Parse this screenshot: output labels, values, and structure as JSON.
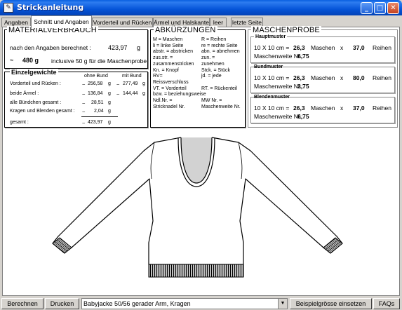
{
  "window": {
    "title": "Strickanleitung",
    "minimize": "_",
    "maximize": "□",
    "close": "✕"
  },
  "tabs": [
    "Angaben",
    "Schnitt und Angaben",
    "Vorderteil und Rücken",
    "Ärmel und Halskante",
    "leer",
    "letzte Seite"
  ],
  "material": {
    "title": "MATERIALVERBRAUCH",
    "calc_label": "nach den Angaben berechnet :",
    "calc_value": "423,97",
    "calc_unit": "g",
    "tilde": "~",
    "total": "480 g",
    "total_note": "inclusive 50 g für die Maschenprobe"
  },
  "einzel": {
    "title": "Einzelgewichte",
    "col1": "ohne Bund",
    "col2": "mit Bund",
    "rows": [
      {
        "label": "Vorderteil und Rücken :",
        "v1": "256,58",
        "u1": "g",
        "v2": "277,49",
        "u2": "g"
      },
      {
        "label": "beide Ärmel :",
        "v1": "136,84",
        "u1": "g",
        "v2": "144,44",
        "u2": "g"
      },
      {
        "label": "alle Bündchen gesamt :",
        "v1": "28,51",
        "u1": "g",
        "v2": "",
        "u2": ""
      },
      {
        "label": "Kragen und Blenden gesamt :",
        "v1": "2,04",
        "u1": "g",
        "v2": "",
        "u2": ""
      }
    ],
    "total_label": "gesamt :",
    "total_value": "423,97",
    "total_unit": "g"
  },
  "abk": {
    "title": "ABKÜRZUNGEN",
    "left": [
      "M = Maschen",
      "li = linke Seite",
      "abstr. = abstricken",
      "zus.str. =",
      "zusammenstricken",
      "Kn. = Knopf",
      "RV=",
      "Reissverschluss",
      "VT. = Vorderteil",
      "bzw. = beziehungsweise",
      "Ndl.Nr. =",
      "Stricknadel Nr."
    ],
    "right": [
      "R = Reihen",
      "re = rechte Seite",
      "abn. = abnehmen",
      "zun. =",
      "zunehmen",
      "Stck. = Stück",
      "jd. = jede",
      "",
      "RT. = Rückenteil",
      "",
      "MW Nr. =",
      "Maschenweite Nr."
    ]
  },
  "probe": {
    "title": "MASCHENPROBE",
    "maschen": "Maschen",
    "x": "x",
    "reihen": "Reihen",
    "mw_label": "Maschenweite Nr.:",
    "size_label": "10 X 10 cm =",
    "boxes": [
      {
        "name": "Hauptmuster",
        "m": "26,3",
        "r": "37,0",
        "mw": "6,75"
      },
      {
        "name": "Bundmuster",
        "m": "26,3",
        "r": "80,0",
        "mw": "3,75"
      },
      {
        "name": "Blendenmuster",
        "m": "26,3",
        "r": "37,0",
        "mw": "6,75"
      }
    ]
  },
  "statusbar": {
    "berechnen": "Berechnen",
    "drucken": "Drucken",
    "combo": "Babyjacke 50/56     gerader Arm, Kragen",
    "combo_arrow": "▼",
    "beispiel": "Beispielgrösse einsetzen",
    "faqs": "FAQs"
  }
}
